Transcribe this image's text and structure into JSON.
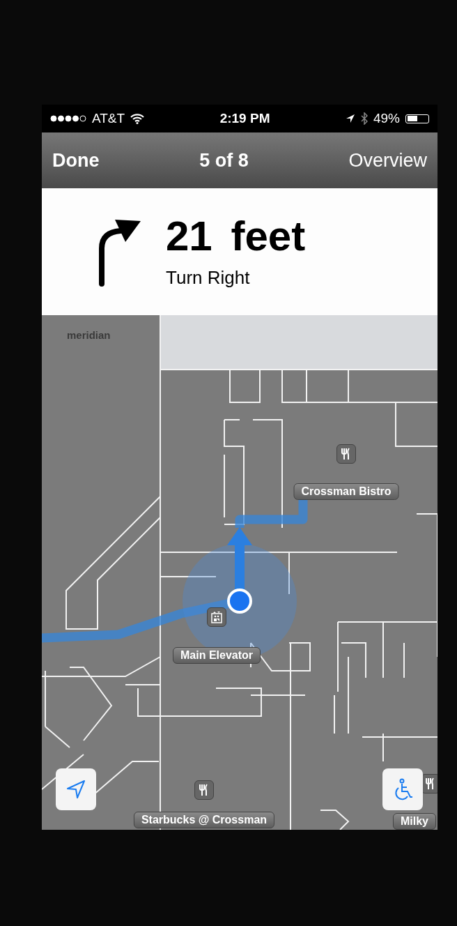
{
  "status_bar": {
    "carrier": "AT&T",
    "time": "2:19 PM",
    "battery_text": "49%",
    "battery": {
      "level": 0.49
    }
  },
  "nav_bar": {
    "left_button": "Done",
    "title": "5 of 8",
    "right_button": "Overview"
  },
  "instruction": {
    "distance": "21 feet",
    "action": "Turn Right"
  },
  "map": {
    "attribution": "meridian",
    "pois": [
      {
        "name": "Crossman Bistro",
        "kind": "restaurant"
      },
      {
        "name": "Main Elevator",
        "kind": "elevator"
      },
      {
        "name": "Starbucks @ Crossman",
        "kind": "restaurant"
      },
      {
        "name": "Milky",
        "kind": "restaurant"
      }
    ]
  }
}
